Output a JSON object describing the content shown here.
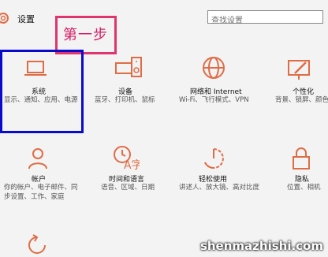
{
  "header": {
    "title": "设置"
  },
  "search": {
    "placeholder": "查找设置"
  },
  "annotation": {
    "label": "第一步"
  },
  "tiles": [
    {
      "title": "系统",
      "desc": "显示、通知、应用、电源",
      "icon": "laptop-icon"
    },
    {
      "title": "设备",
      "desc": "蓝牙、打印机、鼠标",
      "icon": "devices-icon"
    },
    {
      "title": "网络和 Internet",
      "desc": "Wi-Fi、飞行模式、VPN",
      "icon": "globe-icon"
    },
    {
      "title": "个性化",
      "desc": "背景、锁屏、颜色",
      "icon": "paintbrush-icon"
    },
    {
      "title": "帐户",
      "desc": "你的帐户、电子邮件、同步设置、工作、家庭",
      "icon": "person-icon"
    },
    {
      "title": "时间和语言",
      "desc": "语音、区域、日期",
      "icon": "time-language-icon"
    },
    {
      "title": "轻松使用",
      "desc": "讲述人、放大镜、高对比度",
      "icon": "ease-of-access-icon"
    },
    {
      "title": "隐私",
      "desc": "位置、相机",
      "icon": "lock-icon"
    },
    {
      "title": "",
      "desc": "",
      "icon": "update-icon"
    }
  ],
  "watermark": {
    "text": "shenmazhishi.com"
  },
  "colors": {
    "accent": "#e06c45",
    "highlight": "#0a0acd",
    "annotation": "#e0346e"
  }
}
